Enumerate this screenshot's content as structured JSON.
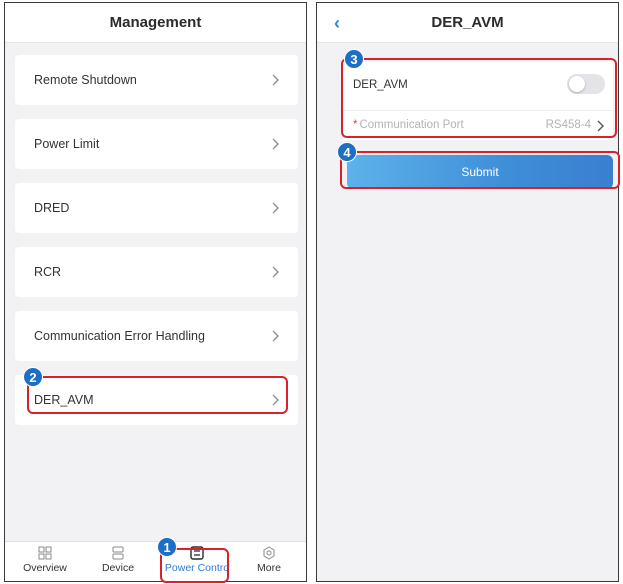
{
  "left": {
    "title": "Management",
    "items": [
      {
        "label": "Remote Shutdown"
      },
      {
        "label": "Power Limit"
      },
      {
        "label": "DRED"
      },
      {
        "label": "RCR"
      },
      {
        "label": "Communication Error Handling"
      },
      {
        "label": "DER_AVM"
      }
    ],
    "tabs": [
      {
        "label": "Overview",
        "icon": "grid-icon"
      },
      {
        "label": "Device",
        "icon": "device-icon"
      },
      {
        "label": "Power Contro",
        "icon": "power-control-icon",
        "active": true
      },
      {
        "label": "More",
        "icon": "gear-icon"
      }
    ]
  },
  "right": {
    "title": "DER_AVM",
    "der_label": "DER_AVM",
    "toggle_on": false,
    "required_mark": "*",
    "port_label": "Communication Port",
    "port_value": "RS458-4",
    "submit_label": "Submit"
  },
  "badges": [
    "1",
    "2",
    "3",
    "4"
  ],
  "colors": {
    "accent": "#2f7bd6",
    "callout": "#d8222b",
    "badge": "#1c6fc4"
  }
}
